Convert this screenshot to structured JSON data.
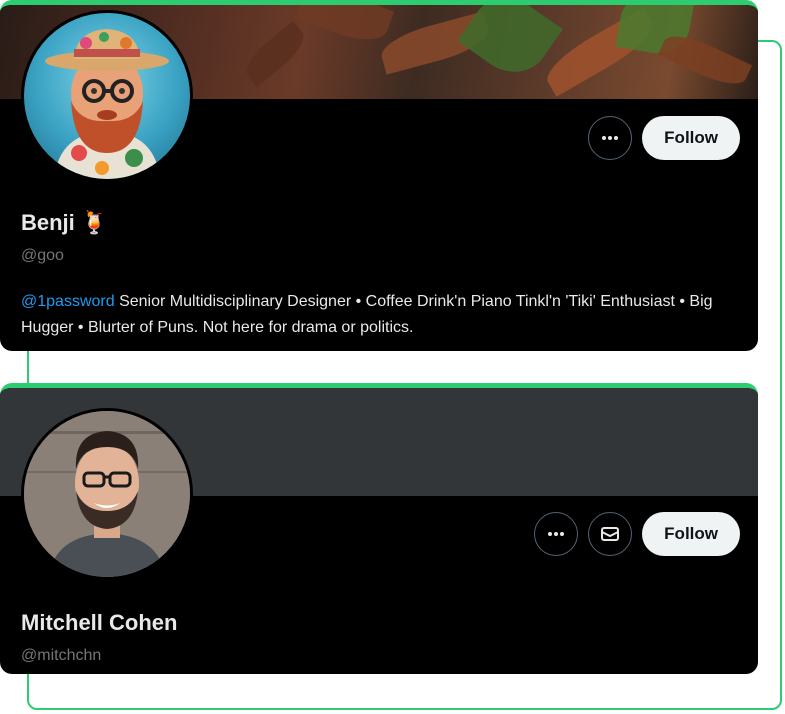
{
  "profiles": [
    {
      "name": "Benji",
      "name_emoji": "🍹",
      "handle": "@goo",
      "bio_mention": "@1password",
      "bio_text": "Senior Multidisciplinary Designer • Coffee Drink'n Piano Tinkl'n 'Tiki' Enthusiast • Big Hugger • Blurter of Puns. Not here for drama or politics.",
      "follow_label": "Follow",
      "more_icon": "more-horizontal-icon"
    },
    {
      "name": "Mitchell Cohen",
      "handle": "@mitchchn",
      "follow_label": "Follow",
      "more_icon": "more-horizontal-icon",
      "message_icon": "envelope-icon"
    }
  ],
  "colors": {
    "accent_green": "#2ecc71",
    "card_bg": "#000000",
    "link_blue": "#1d9bf0",
    "follow_bg": "#eff3f4",
    "muted_text": "#71767b"
  }
}
